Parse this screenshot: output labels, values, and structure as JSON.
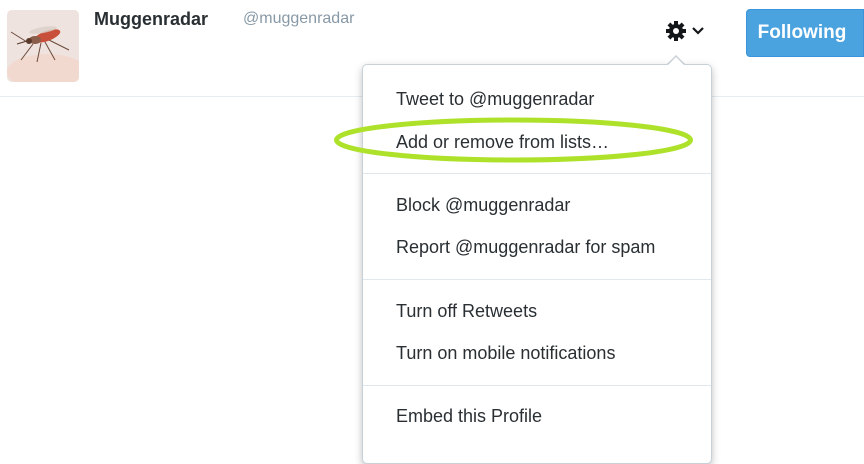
{
  "profile": {
    "name": "Muggenradar",
    "handle": "@muggenradar"
  },
  "follow_button": {
    "label": "Following"
  },
  "menu": {
    "items": [
      "Tweet to @muggenradar",
      "Add or remove from lists…",
      "Block @muggenradar",
      "Report @muggenradar for spam",
      "Turn off Retweets",
      "Turn on mobile notifications",
      "Embed this Profile"
    ]
  },
  "colors": {
    "follow_bg": "#4aa3df",
    "highlight_ellipse": "#aee12a"
  },
  "icons": [
    "gear-icon",
    "chevron-down-icon"
  ]
}
